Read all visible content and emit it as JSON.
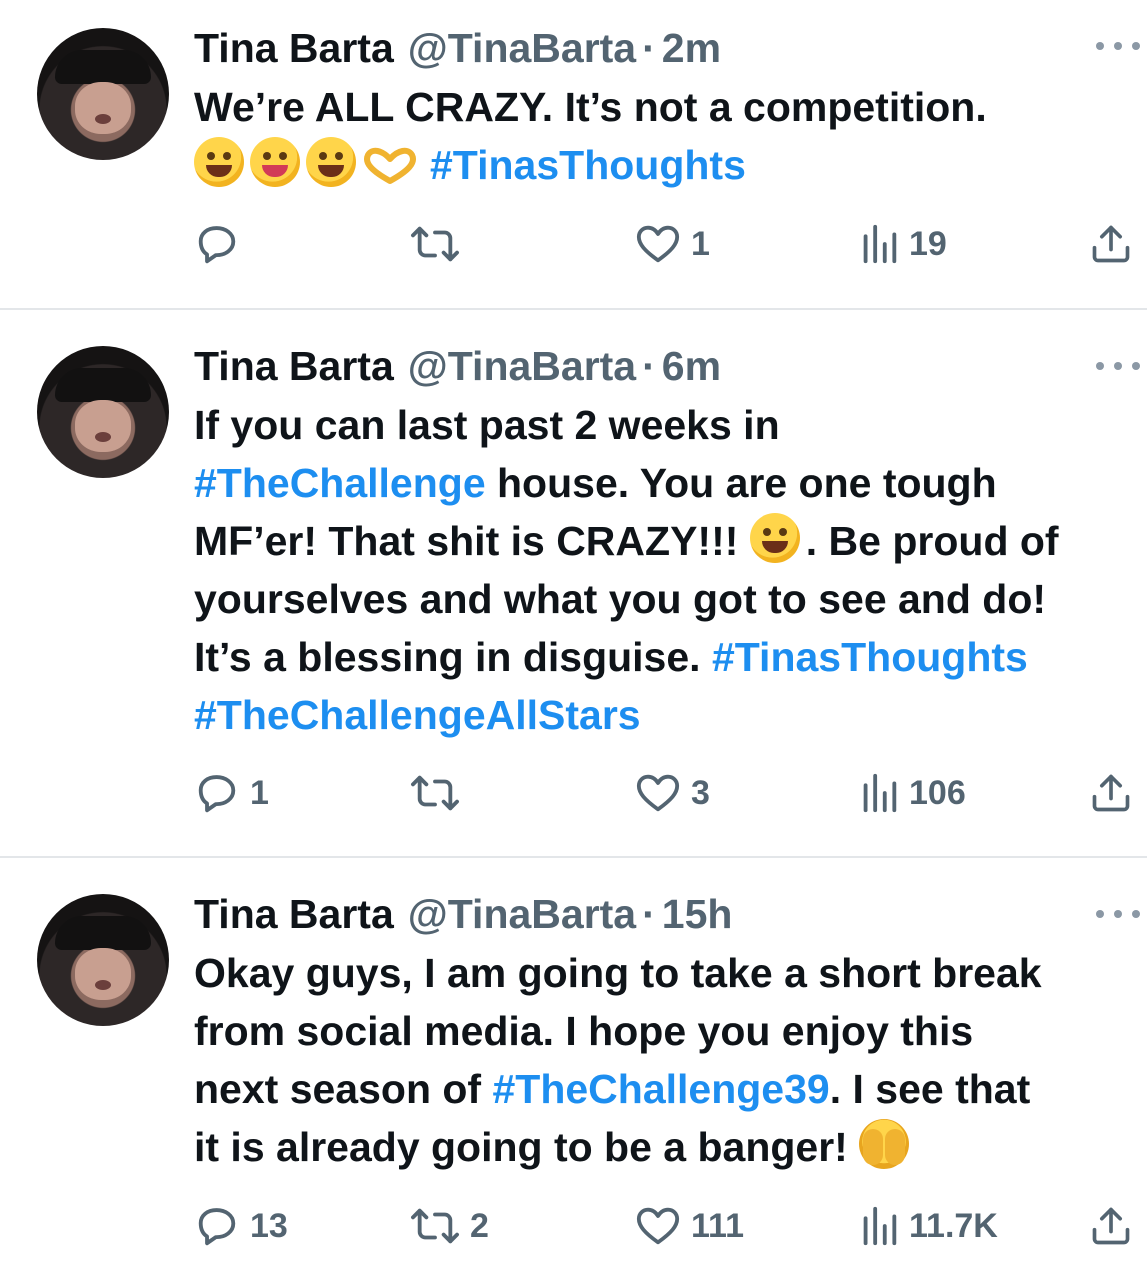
{
  "colors": {
    "hashtag": "#1d8ef0",
    "muted": "#536471",
    "text": "#0f1419"
  },
  "tweets": [
    {
      "name": "Tina Barta",
      "handle": "@TinaBarta",
      "separator": "·",
      "time": "2m",
      "lines": [
        [
          {
            "t": "text",
            "v": "We’re ALL CRAZY.  It’s not a competition."
          }
        ],
        [
          {
            "t": "emoji",
            "icon": "rofl-emoji"
          },
          {
            "t": "emoji",
            "icon": "zany-face-emoji"
          },
          {
            "t": "emoji",
            "icon": "kissing-face-emoji"
          },
          {
            "t": "heart-hands",
            "icon": "heart-hands-emoji"
          },
          {
            "t": "tag",
            "v": "#TinasThoughts"
          }
        ]
      ],
      "stats": {
        "replies": "",
        "retweets": "",
        "likes": "1",
        "views": "19"
      }
    },
    {
      "name": "Tina Barta",
      "handle": "@TinaBarta",
      "separator": "·",
      "time": "6m",
      "lines": [
        [
          {
            "t": "text",
            "v": "If you can last past 2 weeks in"
          }
        ],
        [
          {
            "t": "tag",
            "v": "#TheChallenge"
          },
          {
            "t": "text",
            "v": " house.  You are one tough"
          }
        ],
        [
          {
            "t": "text",
            "v": "MF’er!  That shit is CRAZY!!! "
          },
          {
            "t": "emoji",
            "icon": "rofl-emoji"
          },
          {
            "t": "text",
            "v": ". Be proud of"
          }
        ],
        [
          {
            "t": "text",
            "v": "yourselves and what you got to see and do!"
          }
        ],
        [
          {
            "t": "text",
            "v": "It’s a blessing in disguise. "
          },
          {
            "t": "tag",
            "v": "#TinasThoughts"
          }
        ],
        [
          {
            "t": "tag",
            "v": "#TheChallengeAllStars"
          }
        ]
      ],
      "stats": {
        "replies": "1",
        "retweets": "",
        "likes": "3",
        "views": "106"
      }
    },
    {
      "name": "Tina Barta",
      "handle": "@TinaBarta",
      "separator": "·",
      "time": "15h",
      "lines": [
        [
          {
            "t": "text",
            "v": "Okay guys, I am going to take a short break"
          }
        ],
        [
          {
            "t": "text",
            "v": "from social media.  I hope you enjoy this"
          }
        ],
        [
          {
            "t": "text",
            "v": "next season of "
          },
          {
            "t": "tag",
            "v": "#TheChallenge39"
          },
          {
            "t": "text",
            "v": ".  I see that"
          }
        ],
        [
          {
            "t": "text",
            "v": "it is already going to be a banger! "
          },
          {
            "t": "emoji",
            "icon": "face-with-open-eyes-hand-over-mouth-emoji"
          }
        ]
      ],
      "stats": {
        "replies": "13",
        "retweets": "2",
        "likes": "111",
        "views": "11.7K"
      }
    }
  ]
}
